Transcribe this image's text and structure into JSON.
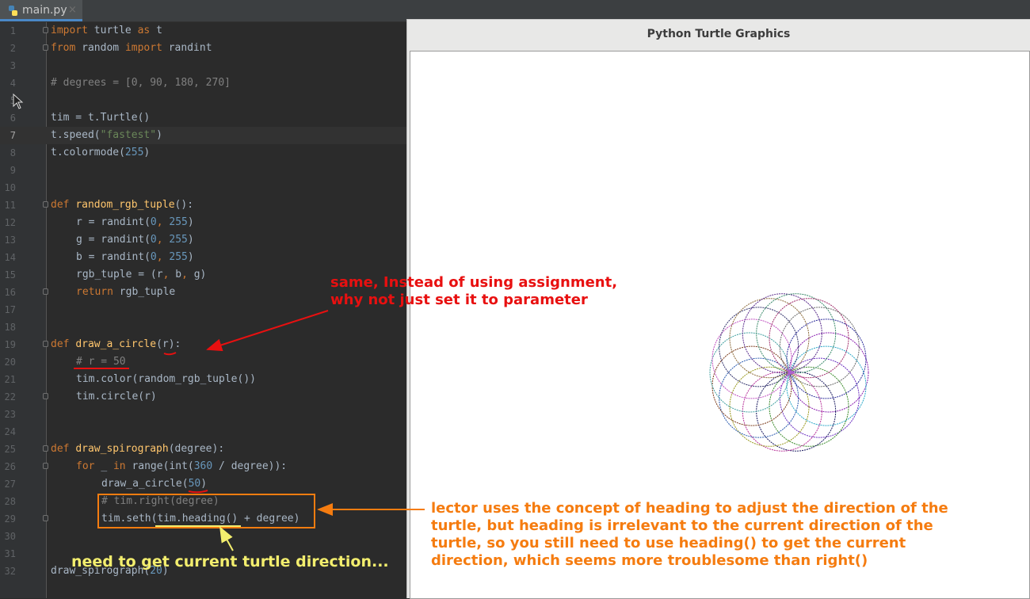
{
  "tab": {
    "filename": "main.py",
    "close_glyph": "×",
    "icon": "python-file-icon"
  },
  "editor": {
    "current_line": 7,
    "lines": [
      {
        "n": "1",
        "fold": true,
        "indent": 0,
        "tokens": [
          {
            "t": "import",
            "c": "kw"
          },
          {
            "t": " turtle ",
            "c": ""
          },
          {
            "t": "as",
            "c": "kw"
          },
          {
            "t": " t",
            "c": ""
          }
        ]
      },
      {
        "n": "2",
        "fold": true,
        "indent": 0,
        "tokens": [
          {
            "t": "from",
            "c": "kw"
          },
          {
            "t": " random ",
            "c": ""
          },
          {
            "t": "import",
            "c": "kw"
          },
          {
            "t": " randint",
            "c": ""
          }
        ]
      },
      {
        "n": "3",
        "indent": 0,
        "tokens": []
      },
      {
        "n": "4",
        "indent": 0,
        "tokens": [
          {
            "t": "# degrees = [0, 90, 180, 270]",
            "c": "cm"
          }
        ]
      },
      {
        "n": "5",
        "indent": 0,
        "tokens": []
      },
      {
        "n": "6",
        "indent": 0,
        "tokens": [
          {
            "t": "tim = t.Turtle()",
            "c": ""
          }
        ]
      },
      {
        "n": "7",
        "indent": 0,
        "tokens": [
          {
            "t": "t.speed(",
            "c": ""
          },
          {
            "t": "\"fastest\"",
            "c": "str"
          },
          {
            "t": ")",
            "c": ""
          }
        ]
      },
      {
        "n": "8",
        "indent": 0,
        "tokens": [
          {
            "t": "t.colormode(",
            "c": ""
          },
          {
            "t": "255",
            "c": "num"
          },
          {
            "t": ")",
            "c": ""
          }
        ]
      },
      {
        "n": "9",
        "indent": 0,
        "tokens": []
      },
      {
        "n": "10",
        "indent": 0,
        "tokens": []
      },
      {
        "n": "11",
        "fold": true,
        "indent": 0,
        "tokens": [
          {
            "t": "def ",
            "c": "kw"
          },
          {
            "t": "random_rgb_tuple",
            "c": "fn"
          },
          {
            "t": "():",
            "c": ""
          }
        ]
      },
      {
        "n": "12",
        "indent": 1,
        "tokens": [
          {
            "t": "r = randint(",
            "c": ""
          },
          {
            "t": "0",
            "c": "num"
          },
          {
            "t": ", ",
            "c": "kw"
          },
          {
            "t": "255",
            "c": "num"
          },
          {
            "t": ")",
            "c": ""
          }
        ]
      },
      {
        "n": "13",
        "indent": 1,
        "tokens": [
          {
            "t": "g = randint(",
            "c": ""
          },
          {
            "t": "0",
            "c": "num"
          },
          {
            "t": ", ",
            "c": "kw"
          },
          {
            "t": "255",
            "c": "num"
          },
          {
            "t": ")",
            "c": ""
          }
        ]
      },
      {
        "n": "14",
        "indent": 1,
        "tokens": [
          {
            "t": "b = randint(",
            "c": ""
          },
          {
            "t": "0",
            "c": "num"
          },
          {
            "t": ", ",
            "c": "kw"
          },
          {
            "t": "255",
            "c": "num"
          },
          {
            "t": ")",
            "c": ""
          }
        ]
      },
      {
        "n": "15",
        "indent": 1,
        "tokens": [
          {
            "t": "rgb_tuple = (r",
            "c": ""
          },
          {
            "t": ", ",
            "c": "kw"
          },
          {
            "t": "b",
            "c": ""
          },
          {
            "t": ", ",
            "c": "kw"
          },
          {
            "t": "g)",
            "c": ""
          }
        ]
      },
      {
        "n": "16",
        "fold": true,
        "indent": 1,
        "tokens": [
          {
            "t": "return ",
            "c": "kw"
          },
          {
            "t": "rgb_tuple",
            "c": ""
          }
        ]
      },
      {
        "n": "17",
        "indent": 0,
        "tokens": []
      },
      {
        "n": "18",
        "indent": 0,
        "tokens": []
      },
      {
        "n": "19",
        "fold": true,
        "indent": 0,
        "tokens": [
          {
            "t": "def ",
            "c": "kw"
          },
          {
            "t": "draw_a_circle",
            "c": "fn"
          },
          {
            "t": "(r):",
            "c": ""
          }
        ]
      },
      {
        "n": "20",
        "indent": 1,
        "tokens": [
          {
            "t": "# r = 50",
            "c": "cm"
          }
        ]
      },
      {
        "n": "21",
        "indent": 1,
        "tokens": [
          {
            "t": "tim.color(random_rgb_tuple())",
            "c": ""
          }
        ]
      },
      {
        "n": "22",
        "fold": true,
        "indent": 1,
        "tokens": [
          {
            "t": "tim.circle(r)",
            "c": ""
          }
        ]
      },
      {
        "n": "23",
        "indent": 0,
        "tokens": []
      },
      {
        "n": "24",
        "indent": 0,
        "tokens": []
      },
      {
        "n": "25",
        "fold": true,
        "indent": 0,
        "tokens": [
          {
            "t": "def ",
            "c": "kw"
          },
          {
            "t": "draw_spirograph",
            "c": "fn"
          },
          {
            "t": "(degree):",
            "c": ""
          }
        ]
      },
      {
        "n": "26",
        "fold": true,
        "indent": 1,
        "tokens": [
          {
            "t": "for ",
            "c": "kw"
          },
          {
            "t": "_ ",
            "c": ""
          },
          {
            "t": "in ",
            "c": "kw"
          },
          {
            "t": "range(int(",
            "c": ""
          },
          {
            "t": "360",
            "c": "num"
          },
          {
            "t": " / degree)):",
            "c": ""
          }
        ]
      },
      {
        "n": "27",
        "indent": 2,
        "tokens": [
          {
            "t": "draw_a_circle(",
            "c": ""
          },
          {
            "t": "50",
            "c": "num"
          },
          {
            "t": ")",
            "c": ""
          }
        ]
      },
      {
        "n": "28",
        "indent": 2,
        "tokens": [
          {
            "t": "# tim.right(degree)",
            "c": "cm"
          }
        ]
      },
      {
        "n": "29",
        "fold": true,
        "indent": 2,
        "tokens": [
          {
            "t": "tim.seth(tim.heading() + degree)",
            "c": ""
          }
        ]
      },
      {
        "n": "30",
        "indent": 0,
        "tokens": []
      },
      {
        "n": "31",
        "indent": 0,
        "tokens": []
      },
      {
        "n": "32",
        "indent": 0,
        "tokens": [
          {
            "t": "draw_spirograph(",
            "c": ""
          },
          {
            "t": "20",
            "c": "num"
          },
          {
            "t": ")",
            "c": ""
          }
        ]
      }
    ]
  },
  "turtle_window": {
    "title": "Python Turtle Graphics",
    "spirograph": {
      "circle_count": 18,
      "palette": [
        "#8a1fb0",
        "#2aa8c8",
        "#6a2ec0",
        "#3c8c2c",
        "#1a1a60",
        "#b8349a",
        "#9a9a20",
        "#2c5cb0",
        "#7a3a1a",
        "#40a0a0",
        "#c050c0",
        "#30306a",
        "#8c6a3a",
        "#5a2c8c",
        "#3a8a6a",
        "#a02c6a",
        "#6a6a6a",
        "#2c2c9a"
      ]
    }
  },
  "annotations": {
    "red": [
      "same, Instead of using assignment,",
      "why not just set it to parameter"
    ],
    "orange": [
      "lector uses the concept of heading to adjust the direction of the",
      "turtle, but heading is irrelevant to the current direction of the",
      "turtle, so you still need to use heading() to get the current",
      "direction, which seems more troublesome than right()"
    ],
    "yellow": "need to get current turtle direction...",
    "colors": {
      "red": "#e81010",
      "orange": "#f57c10",
      "yellow": "#f3ee6e"
    }
  }
}
